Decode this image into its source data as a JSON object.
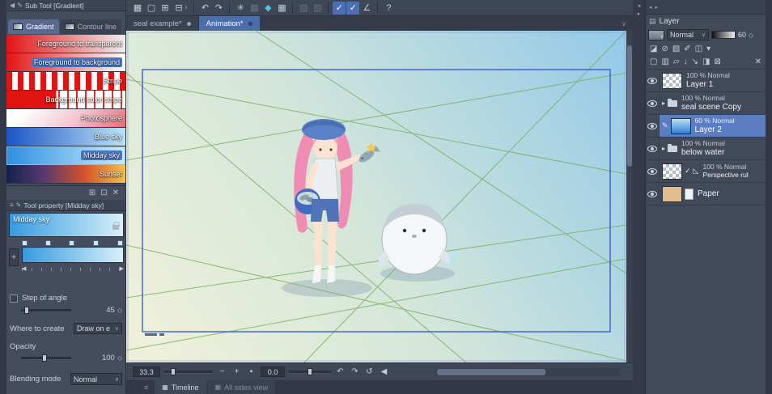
{
  "colors": {
    "window_bg": "#3a4150",
    "panel_bg": "#454c5d",
    "accent_blue": "#4a6fb5",
    "selection_blue": "#5b7ec2",
    "active_tab_blue": "#4d6da8",
    "canvas_sky": "#96cbe8",
    "canvas_cream": "#f0f0d8",
    "perspective_green": "#6fae57",
    "frame_blue": "#3b5bd6"
  },
  "icons": {
    "collapse_left": "◀",
    "pen": "✎",
    "menu": "≡",
    "dropdown": "∨",
    "spinner": "◇",
    "plus": "+",
    "minus": "−",
    "fit_square": "▪",
    "rotate_ccw": "↶",
    "rotate_cw": "↷",
    "reset_rotation": "↺",
    "collapse_small": "◀",
    "node_left": "◀",
    "node_right": "▶",
    "expand_arrow": "▸",
    "check": "✓",
    "ruler_triangle": "◺",
    "pencil": "✎",
    "grid_tab": "▦",
    "panel_grid": "▤",
    "add": "⊞",
    "duplicate": "⊡",
    "trash": "✕",
    "gutter_left": "◂",
    "gutter_right": "▸"
  },
  "subtool": {
    "title": "Sub Tool [Gradient]",
    "tabs": [
      {
        "label": "Gradient"
      },
      {
        "label": "Contour line"
      }
    ],
    "items": [
      {
        "label": "Foreground to transparent"
      },
      {
        "label": "Foreground to background"
      },
      {
        "label": "Stripe"
      },
      {
        "label": "Background color stripe"
      },
      {
        "label": "Photosphere"
      },
      {
        "label": "Blue sky"
      },
      {
        "label": "Midday sky"
      },
      {
        "label": "Sunset"
      }
    ]
  },
  "tool_property": {
    "title": "Tool property [Midday sky]",
    "gradient_name": "Midday sky",
    "step_of_angle_label": "Step of angle",
    "step_of_angle_value": "45",
    "where_to_create_label": "Where to create",
    "where_to_create_value": "Draw on e",
    "opacity_label": "Opacity",
    "opacity_value": "100",
    "blending_mode_label": "Blending mode",
    "blending_mode_value": "Normal"
  },
  "toolbar_icons": [
    {
      "name": "menu-launcher-icon",
      "glyph": "▦"
    },
    {
      "name": "new-document-icon",
      "glyph": "▢"
    },
    {
      "name": "open-document-icon",
      "glyph": "⊞"
    },
    {
      "name": "print-icon",
      "glyph": "⊟"
    },
    {
      "name": "undo-icon",
      "glyph": "↶"
    },
    {
      "name": "redo-icon",
      "glyph": "↷"
    },
    {
      "name": "clear-icon",
      "glyph": "✳"
    },
    {
      "name": "fill-icon",
      "glyph": "▩"
    },
    {
      "name": "auto-select-icon",
      "glyph": "◆"
    },
    {
      "name": "grid-icon",
      "glyph": "▦"
    },
    {
      "name": "gradient-tool-icon",
      "glyph": "▧"
    },
    {
      "name": "pattern-tool-icon",
      "glyph": "▨"
    },
    {
      "name": "snap-to-ruler-icon",
      "glyph": "✓"
    },
    {
      "name": "snap-to-special-ruler-icon",
      "glyph": "✓"
    },
    {
      "name": "snap-to-grid-icon",
      "glyph": "∠"
    },
    {
      "name": "help-icon",
      "glyph": "?"
    }
  ],
  "doc_tabs": [
    {
      "label": "seal example*"
    },
    {
      "label": "Animation*"
    }
  ],
  "statusbar": {
    "zoom": "33.3",
    "rotation": "0.0"
  },
  "bottom_tabs": [
    {
      "label": "Timeline"
    },
    {
      "label": "All sides view"
    }
  ],
  "layer_panel": {
    "title": "Layer",
    "blend_mode": "Normal",
    "opacity_value": "60",
    "tools_row1": [
      {
        "name": "clip-to-below-icon",
        "glyph": "◪"
      },
      {
        "name": "lock-layer-icon",
        "glyph": "⊘"
      },
      {
        "name": "lock-transparency-icon",
        "glyph": "▨"
      },
      {
        "name": "draft-layer-icon",
        "glyph": "✐"
      },
      {
        "name": "layer-mask-icon",
        "glyph": "◫"
      },
      {
        "name": "palette-menu-icon",
        "glyph": "▾"
      }
    ],
    "tools_row2": [
      {
        "name": "new-raster-layer-icon",
        "glyph": "▢"
      },
      {
        "name": "new-vector-layer-icon",
        "glyph": "▥"
      },
      {
        "name": "new-folder-icon",
        "glyph": "▱"
      },
      {
        "name": "merge-down-icon",
        "glyph": "↓"
      },
      {
        "name": "transfer-down-icon",
        "glyph": "↘"
      },
      {
        "name": "create-mask-icon",
        "glyph": "◨"
      },
      {
        "name": "apply-mask-icon",
        "glyph": "⊠"
      },
      {
        "name": "delete-layer-icon",
        "glyph": "✕"
      }
    ],
    "layers": [
      {
        "opacity_text": "100 % Normal",
        "name": "Layer 1"
      },
      {
        "opacity_text": "100 % Normal",
        "name": "seal scene Copy"
      },
      {
        "opacity_text": "60 % Normal",
        "name": "Layer 2"
      },
      {
        "opacity_text": "100 % Normal",
        "name": "below water"
      },
      {
        "opacity_text": "100 % Normal",
        "name": "Perspective rul"
      },
      {
        "name": "Paper"
      }
    ]
  }
}
